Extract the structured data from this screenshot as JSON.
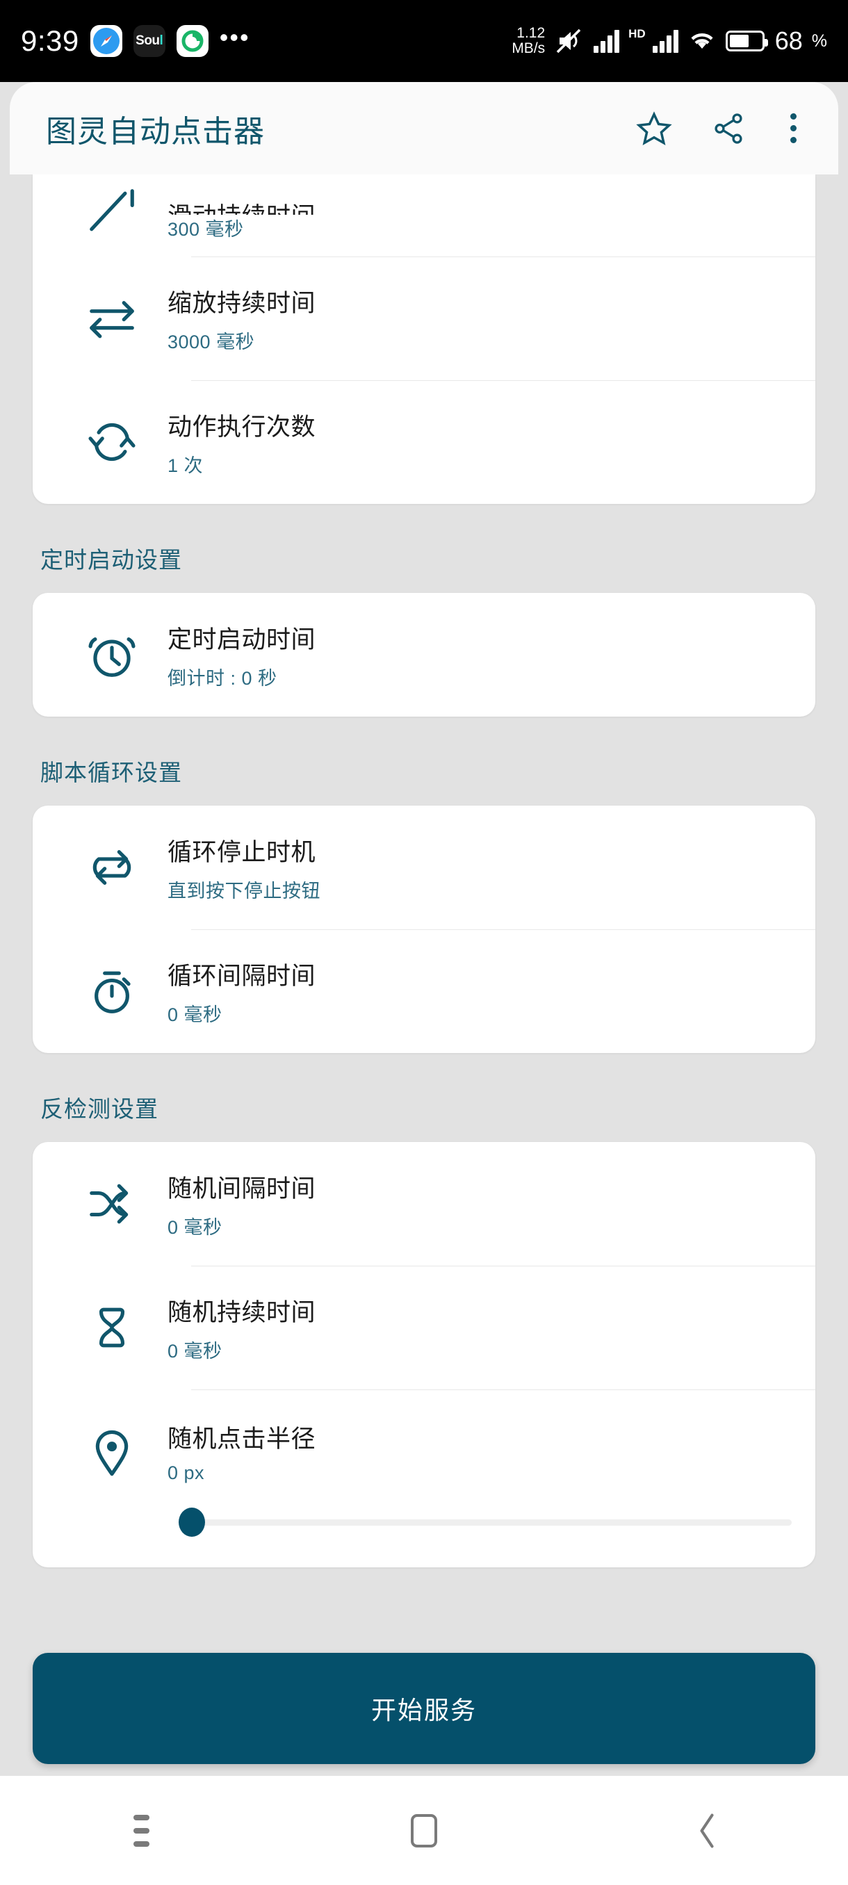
{
  "status_bar": {
    "time": "9:39",
    "app_icons": [
      "safari-icon",
      "soul-app-icon",
      "green-swirl-icon"
    ],
    "more_icon": "•••",
    "net_speed": "1.12",
    "net_speed_unit": "MB/s",
    "mute_icon": "mute-icon",
    "hd_label": "HD",
    "battery_percent": "68",
    "battery_unit": "%"
  },
  "app_bar": {
    "title": "图灵自动点击器",
    "star_icon": "star-icon",
    "share_icon": "share-icon",
    "overflow_icon": "overflow-menu-icon"
  },
  "sections": [
    {
      "header": "",
      "rows": [
        {
          "icon": "swipe-diagonal-icon",
          "title": "滑动持续时间",
          "value": "300 毫秒",
          "partial": true
        },
        {
          "icon": "swap-arrows-icon",
          "title": "缩放持续时间",
          "value": "3000 毫秒"
        },
        {
          "icon": "refresh-cycle-icon",
          "title": "动作执行次数",
          "value": "1 次"
        }
      ]
    },
    {
      "header": "定时启动设置",
      "rows": [
        {
          "icon": "alarm-clock-icon",
          "title": "定时启动时间",
          "value": "倒计时 : 0 秒"
        }
      ]
    },
    {
      "header": "脚本循环设置",
      "rows": [
        {
          "icon": "loop-icon",
          "title": "循环停止时机",
          "value": "直到按下停止按钮"
        },
        {
          "icon": "stopwatch-icon",
          "title": "循环间隔时间",
          "value": "0 毫秒"
        }
      ]
    },
    {
      "header": "反检测设置",
      "rows": [
        {
          "icon": "shuffle-icon",
          "title": "随机间隔时间",
          "value": "0 毫秒"
        },
        {
          "icon": "hourglass-icon",
          "title": "随机持续时间",
          "value": "0 毫秒"
        },
        {
          "icon": "location-pin-icon",
          "title": "随机点击半径",
          "value": "0 px",
          "slider": {
            "value": 0,
            "min": 0,
            "max": 100
          }
        }
      ]
    }
  ],
  "start_button": {
    "label": "开始服务"
  },
  "nav_bar": {
    "recents_icon": "recents-icon",
    "home_icon": "home-icon",
    "back_icon": "back-chevron-icon"
  },
  "colors": {
    "accent": "#05506b",
    "section_header": "#1d5f75",
    "subtitle": "#2d6b82",
    "background": "#e2e2e2",
    "card": "#ffffff"
  }
}
